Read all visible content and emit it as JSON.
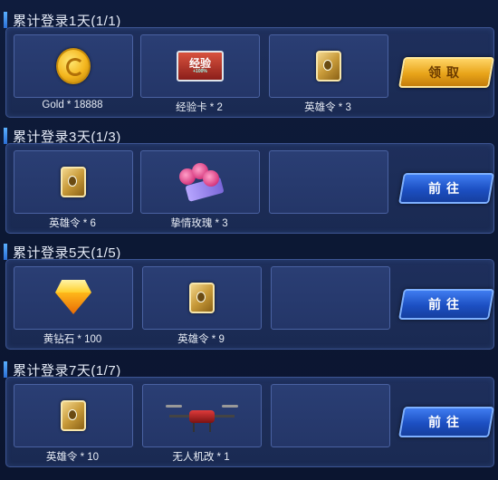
{
  "sections": [
    {
      "title": "累计登录1天(1/1)",
      "button": {
        "label": "领取",
        "kind": "claim"
      },
      "rewards": [
        {
          "icon": "gold-coin-icon",
          "label": "Gold * 18888"
        },
        {
          "icon": "exp-card-icon",
          "label": "经验卡 * 2",
          "card_text": "经验",
          "card_sub": "+100%"
        },
        {
          "icon": "hero-token-icon",
          "label": "英雄令 * 3"
        }
      ]
    },
    {
      "title": "累计登录3天(1/3)",
      "button": {
        "label": "前往",
        "kind": "go"
      },
      "rewards": [
        {
          "icon": "hero-token-icon",
          "label": "英雄令 * 6"
        },
        {
          "icon": "rose-bouquet-icon",
          "label": "挚情玫瑰 * 3"
        },
        {
          "icon": "empty-slot",
          "label": ""
        }
      ]
    },
    {
      "title": "累计登录5天(1/5)",
      "button": {
        "label": "前往",
        "kind": "go"
      },
      "rewards": [
        {
          "icon": "yellow-diamond-icon",
          "label": "黄钻石 * 100"
        },
        {
          "icon": "hero-token-icon",
          "label": "英雄令 * 9"
        },
        {
          "icon": "empty-slot",
          "label": ""
        }
      ]
    },
    {
      "title": "累计登录7天(1/7)",
      "button": {
        "label": "前往",
        "kind": "go"
      },
      "rewards": [
        {
          "icon": "hero-token-icon",
          "label": "英雄令 * 10"
        },
        {
          "icon": "drone-icon",
          "label": "无人机改 * 1"
        },
        {
          "icon": "empty-slot",
          "label": ""
        }
      ]
    }
  ],
  "colors": {
    "claim_button": "#e8a419",
    "go_button": "#1c4fc2",
    "panel": "#1e2f5c",
    "slot": "#2a3e74"
  }
}
